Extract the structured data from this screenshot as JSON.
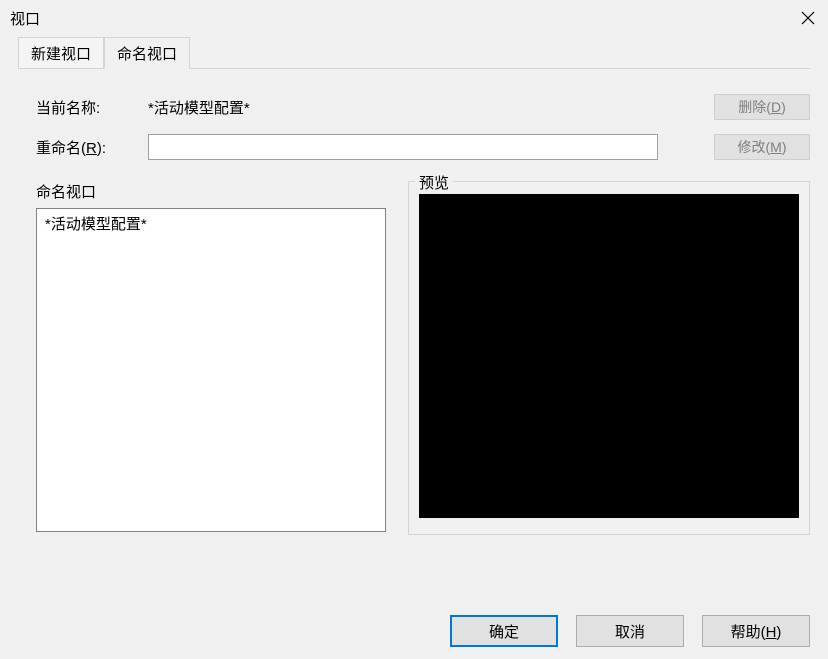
{
  "titlebar": {
    "title": "视口"
  },
  "tabs": [
    {
      "label": "新建视口",
      "active": false
    },
    {
      "label": "命名视口",
      "active": true
    }
  ],
  "form": {
    "currentNameLabel": "当前名称:",
    "currentNameValue": "*活动模型配置*",
    "renameLabel_pre": "重命名(",
    "renameLabel_u": "R",
    "renameLabel_post": "):",
    "renameValue": ""
  },
  "buttons": {
    "delete_pre": "删除(",
    "delete_u": "D",
    "delete_post": ")",
    "modify_pre": "修改(",
    "modify_u": "M",
    "modify_post": ")"
  },
  "sections": {
    "namedLabel": "命名视口",
    "previewLabel": "预览"
  },
  "list": {
    "items": [
      "*活动模型配置*"
    ]
  },
  "footer": {
    "ok": "确定",
    "cancel": "取消",
    "help_pre": "帮助(",
    "help_u": "H",
    "help_post": ")"
  }
}
